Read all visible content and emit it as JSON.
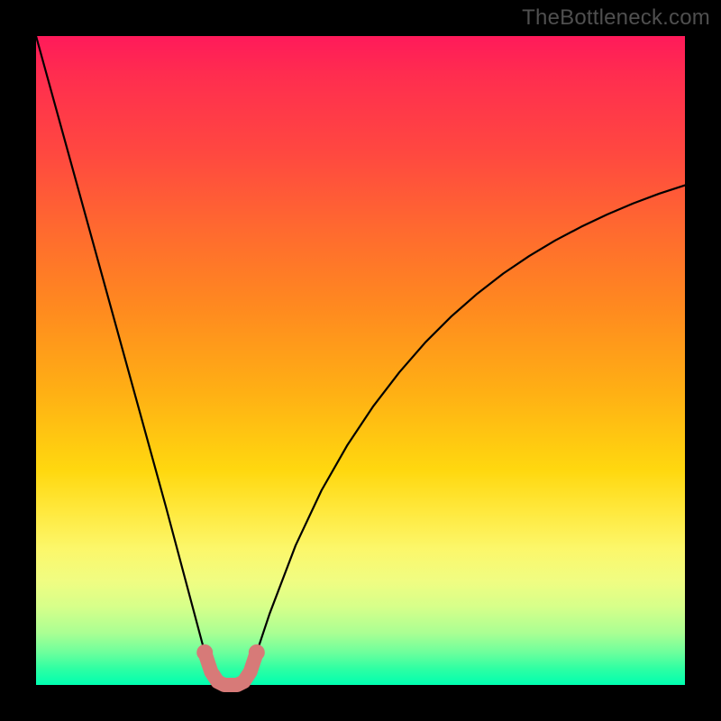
{
  "watermark": "TheBottleneck.com",
  "chart_data": {
    "type": "line",
    "title": "",
    "xlabel": "",
    "ylabel": "",
    "xlim": [
      0,
      100
    ],
    "ylim": [
      0,
      100
    ],
    "grid": false,
    "series": [
      {
        "name": "bottleneck-curve",
        "color": "#000000",
        "x": [
          0,
          4,
          8,
          12,
          16,
          20,
          24,
          26,
          27,
          28,
          29,
          30,
          31,
          32,
          33,
          34,
          36,
          40,
          44,
          48,
          52,
          56,
          60,
          64,
          68,
          72,
          76,
          80,
          84,
          88,
          92,
          96,
          100
        ],
        "y": [
          100,
          85.5,
          71,
          56.5,
          42,
          27.5,
          12.5,
          5,
          2,
          0.5,
          0,
          0,
          0,
          0.5,
          2,
          5,
          11,
          21.5,
          30,
          37,
          43,
          48.2,
          52.8,
          56.8,
          60.3,
          63.4,
          66.1,
          68.5,
          70.6,
          72.5,
          74.2,
          75.7,
          77
        ]
      },
      {
        "name": "optimal-band",
        "color": "#d77a78",
        "kind": "marker-band",
        "x": [
          26,
          27,
          28,
          29,
          30,
          31,
          32,
          33,
          34
        ],
        "y": [
          5,
          2,
          0.5,
          0,
          0,
          0,
          0.5,
          2,
          5
        ]
      }
    ],
    "background_gradient": {
      "orientation": "vertical",
      "stops": [
        {
          "pos": 0.0,
          "color": "#ff1a5a"
        },
        {
          "pos": 0.3,
          "color": "#ff6a2f"
        },
        {
          "pos": 0.67,
          "color": "#ffd80f"
        },
        {
          "pos": 0.88,
          "color": "#d6ff8a"
        },
        {
          "pos": 1.0,
          "color": "#00ffb0"
        }
      ]
    }
  }
}
